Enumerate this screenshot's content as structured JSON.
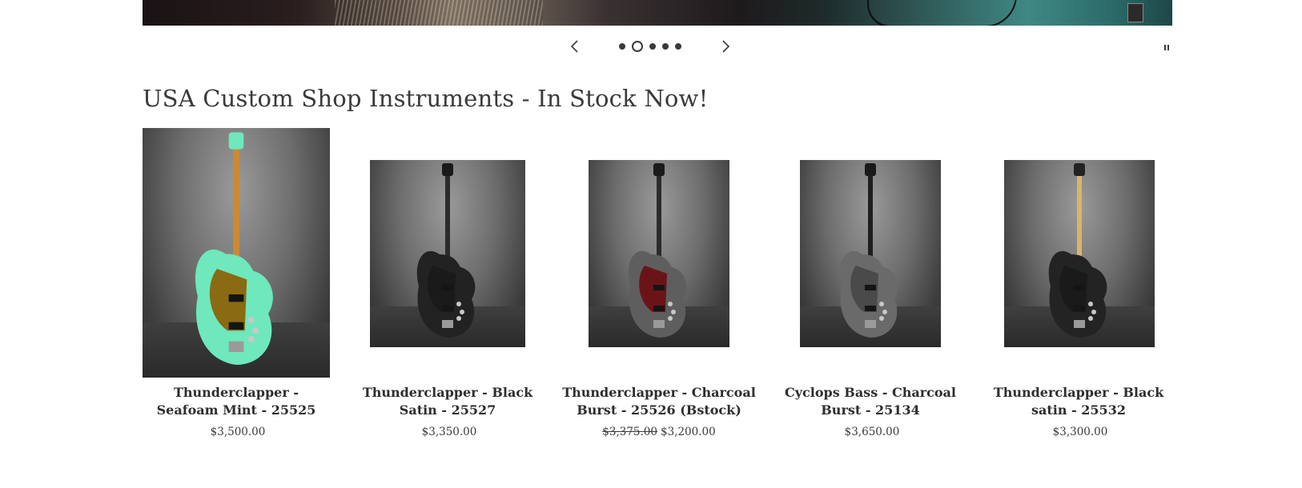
{
  "slideshow": {
    "prev_icon": "chevron-left-icon",
    "next_icon": "chevron-right-icon",
    "pause_icon": "pause-icon",
    "dot_count": 5,
    "active_dot": 2
  },
  "section": {
    "title": "USA Custom Shop Instruments - In Stock Now!"
  },
  "products": [
    {
      "title": "Thunderclapper - Seafoam Mint - 25525",
      "price": "$3,500.00",
      "compare_price": "",
      "colors": {
        "body": "#6ee8bc",
        "pickguard": "#8a6a12",
        "neck": "#c98a35"
      }
    },
    {
      "title": "Thunderclapper - Black Satin - 25527",
      "price": "$3,350.00",
      "compare_price": "",
      "colors": {
        "body": "#222222",
        "pickguard": "#1a1a1a",
        "neck": "#2b2b2b"
      }
    },
    {
      "title": "Thunderclapper - Charcoal Burst - 25526 (Bstock)",
      "price": "$3,200.00",
      "compare_price": "$3,375.00",
      "colors": {
        "body": "#5e5e5e",
        "pickguard": "#6b1418",
        "neck": "#2b2b2b"
      }
    },
    {
      "title": "Cyclops Bass - Charcoal Burst - 25134",
      "price": "$3,650.00",
      "compare_price": "",
      "colors": {
        "body": "#6a6a6a",
        "pickguard": "#4a4a4a",
        "neck": "#1f1f1f"
      }
    },
    {
      "title": "Thunderclapper - Black satin - 25532",
      "price": "$3,300.00",
      "compare_price": "",
      "colors": {
        "body": "#232323",
        "pickguard": "#1a1a1a",
        "neck": "#d8b56a"
      }
    }
  ]
}
